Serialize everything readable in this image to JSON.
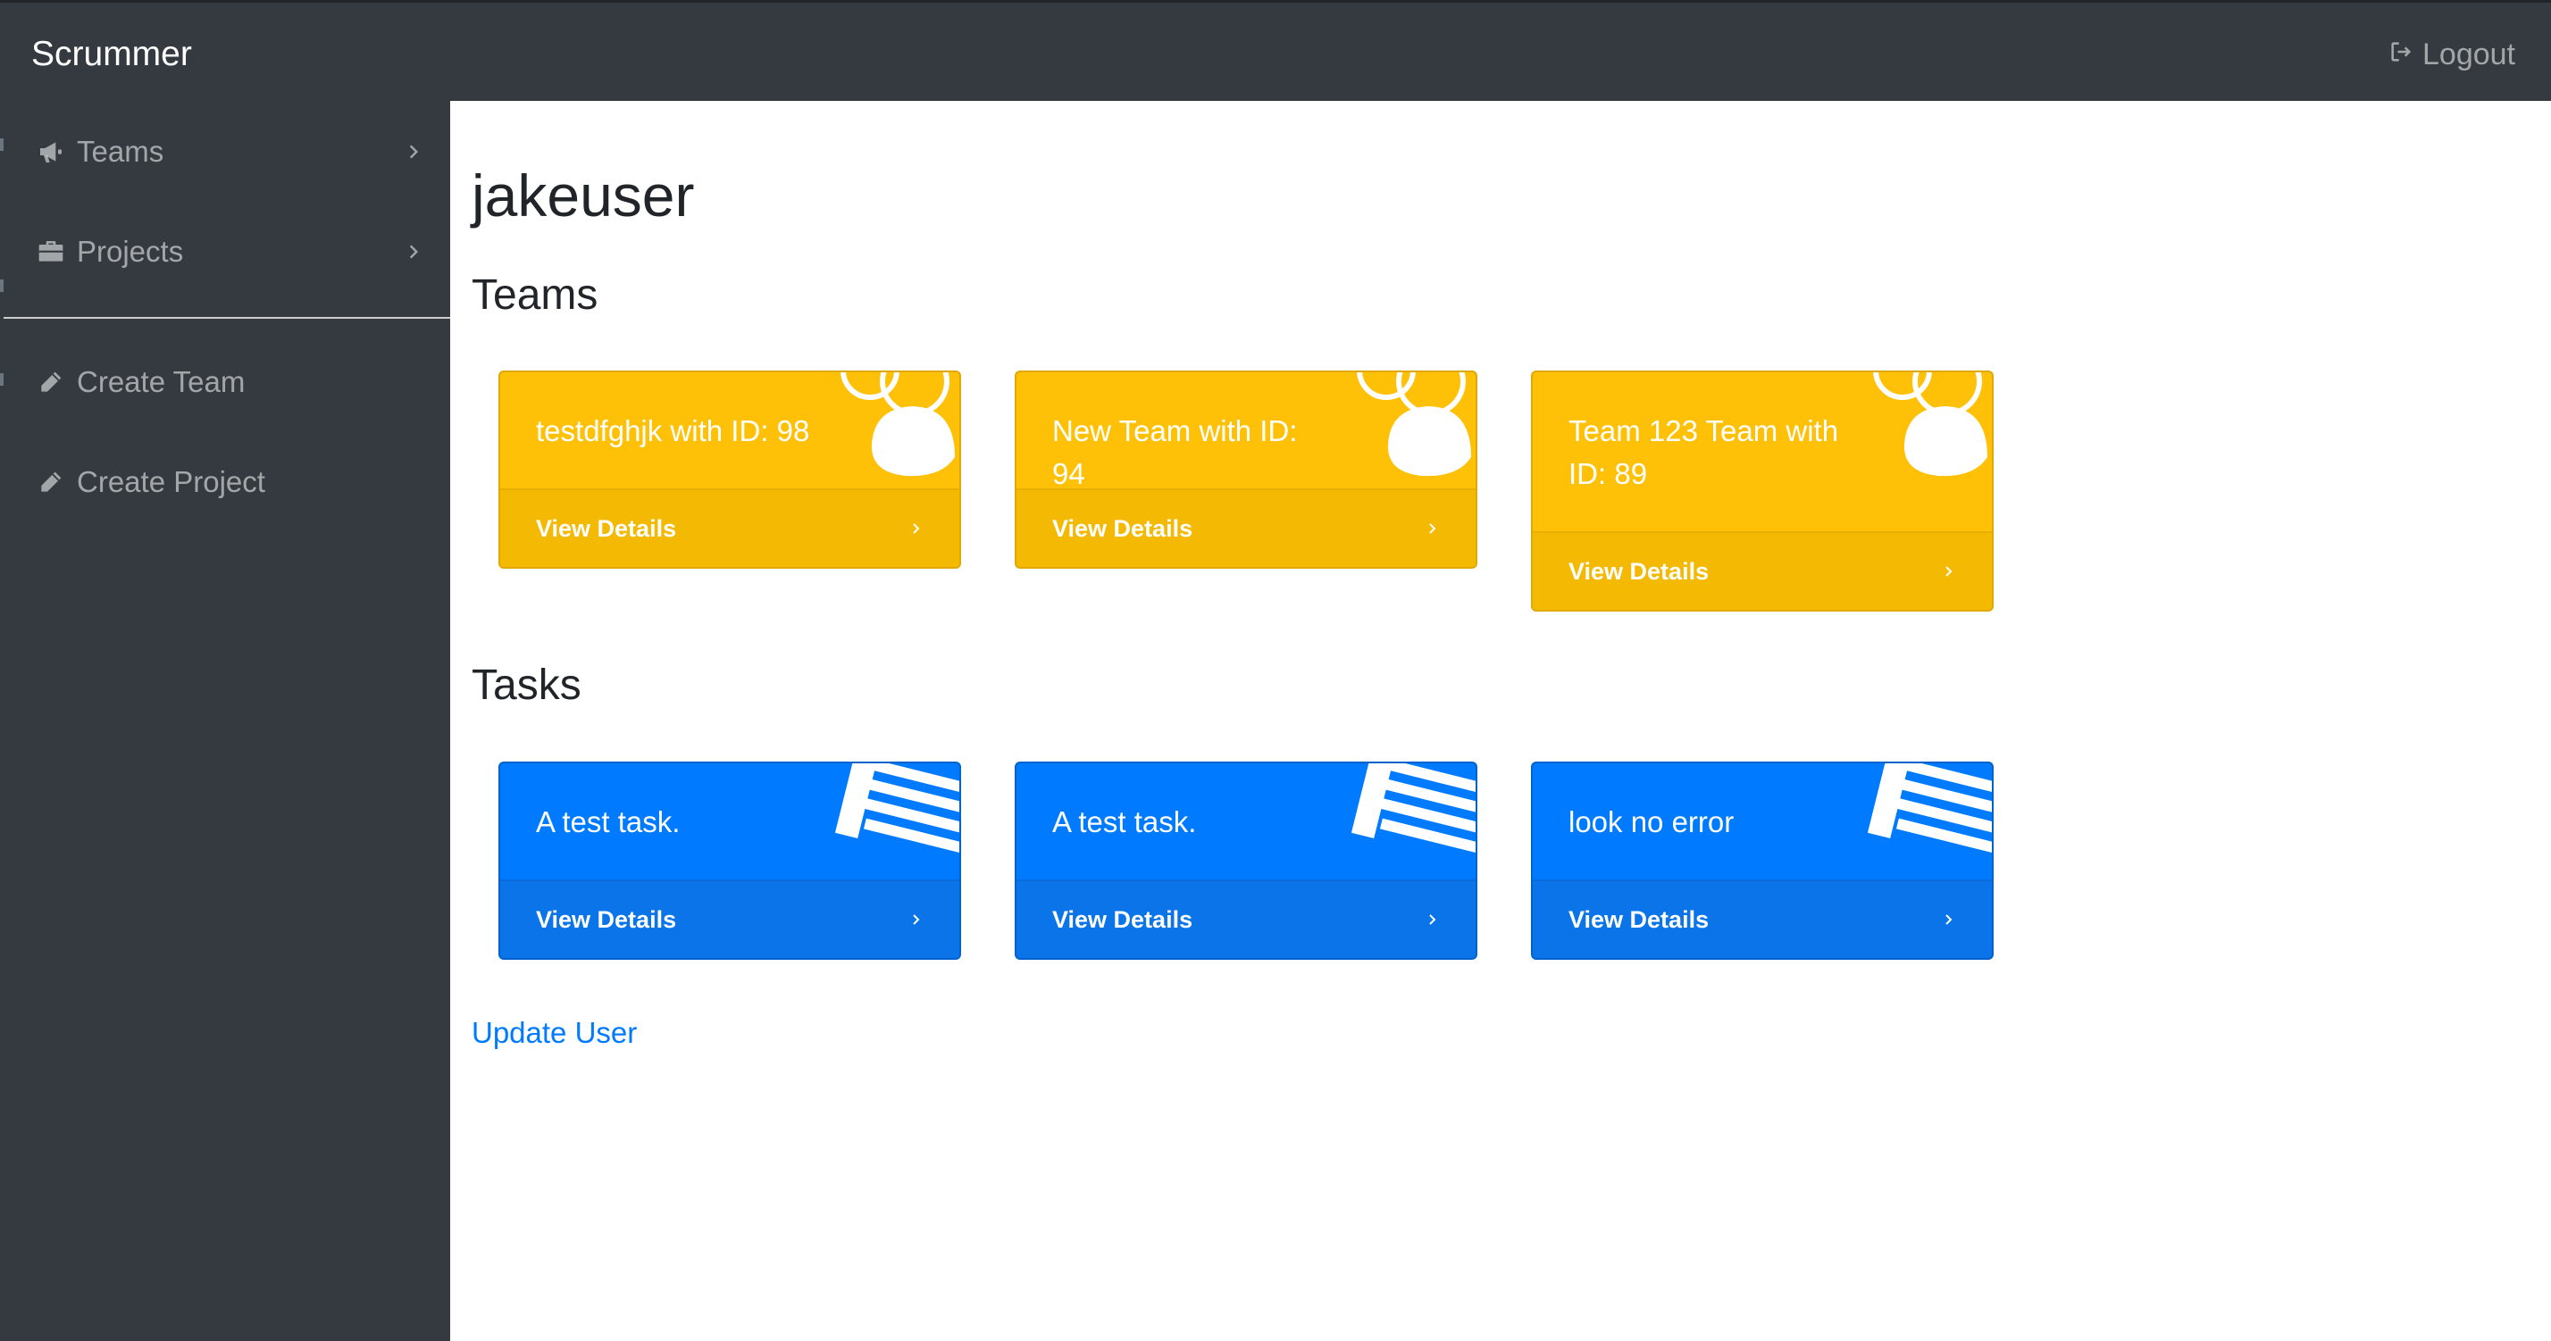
{
  "navbar": {
    "brand": "Scrummer",
    "logout_label": "Logout",
    "logout_icon": "sign-out-icon"
  },
  "sidebar": {
    "items": [
      {
        "label": "Teams",
        "icon": "bullhorn-icon",
        "has_chevron": true
      },
      {
        "label": "Projects",
        "icon": "briefcase-icon",
        "has_chevron": true
      },
      {
        "label": "Create Team",
        "icon": "pencil-icon",
        "has_chevron": false
      },
      {
        "label": "Create Project",
        "icon": "pencil-icon",
        "has_chevron": false
      }
    ]
  },
  "main": {
    "username": "jakeuser",
    "teams_heading": "Teams",
    "teams": [
      {
        "title": "testdfghjk with ID: 98",
        "footer": "View Details",
        "icon": "users-icon"
      },
      {
        "title": "New Team with ID: 94",
        "footer": "View Details",
        "icon": "users-icon"
      },
      {
        "title": "Team 123 Team with ID: 89",
        "footer": "View Details",
        "icon": "users-icon"
      }
    ],
    "tasks_heading": "Tasks",
    "tasks": [
      {
        "title": "A test task.",
        "footer": "View Details",
        "icon": "list-icon"
      },
      {
        "title": "A test task.",
        "footer": "View Details",
        "icon": "list-icon"
      },
      {
        "title": "look no error",
        "footer": "View Details",
        "icon": "list-icon"
      }
    ],
    "update_user_label": "Update User"
  },
  "colors": {
    "sidebar_bg": "#343a40",
    "team_card": "#ffc107",
    "task_card": "#007bff",
    "link": "#007bff"
  }
}
